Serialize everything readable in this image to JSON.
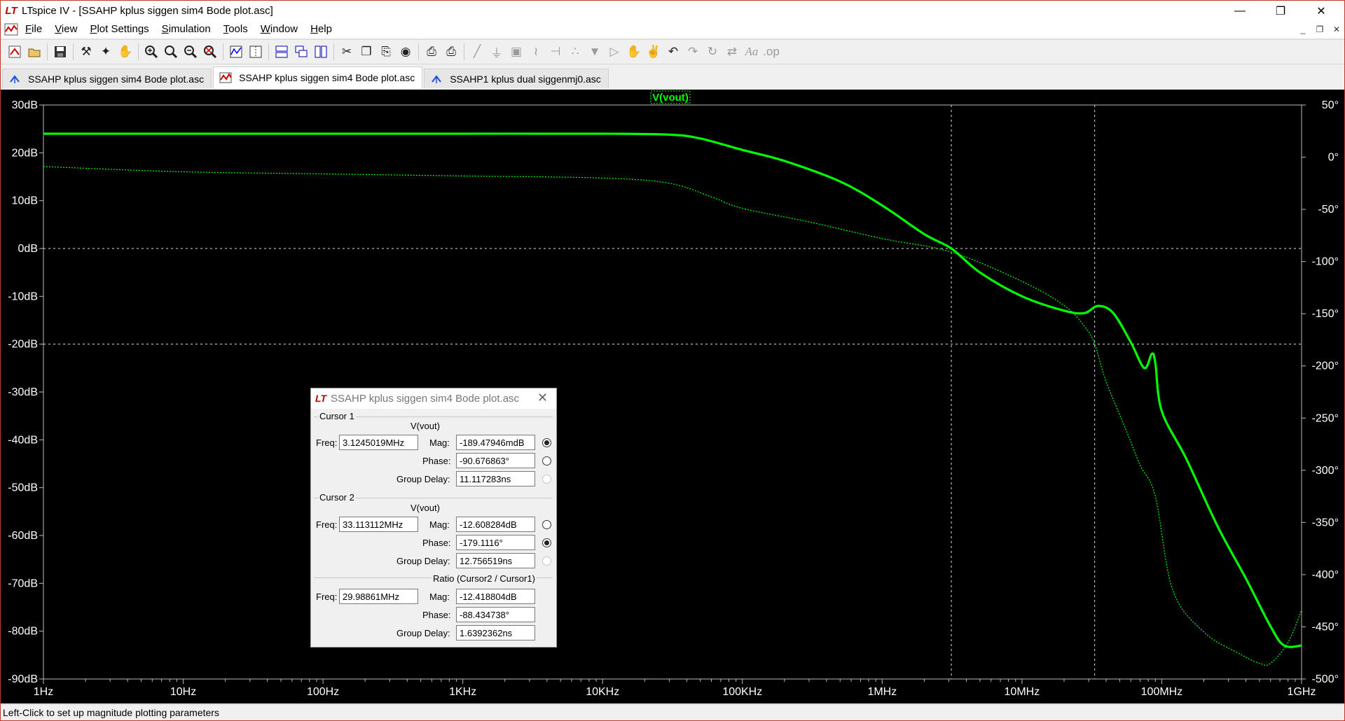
{
  "window": {
    "title": "LTspice IV - [SSAHP kplus siggen sim4 Bode plot.asc]",
    "controls": {
      "minimize": "—",
      "maximize": "❐",
      "close": "✕"
    }
  },
  "menu": {
    "items": [
      "File",
      "View",
      "Plot Settings",
      "Simulation",
      "Tools",
      "Window",
      "Help"
    ],
    "mdi_controls": [
      "_",
      "❐",
      "✕"
    ]
  },
  "toolbar": {
    "icons": [
      "new-schematic-icon",
      "open-icon",
      "save-icon",
      "control-panel-icon",
      "run-icon",
      "pan-hand-icon",
      "zoom-in-icon",
      "zoom-area-icon",
      "zoom-out-icon",
      "zoom-fit-icon",
      "autorange-icon",
      "annotate-icon",
      "tile-horizontal-icon",
      "cascade-icon",
      "tile-icon",
      "cut-icon",
      "copy-icon",
      "paste-icon",
      "find-icon",
      "print-preview-icon",
      "print-icon",
      "wire-icon",
      "ground-icon",
      "label-icon",
      "resistor-icon",
      "capacitor-icon",
      "inductor-icon",
      "diode-icon",
      "component-icon",
      "move-icon",
      "drag-icon",
      "undo-icon",
      "redo-icon",
      "rotate-icon",
      "mirror-icon",
      "text-icon",
      "spice-directive-icon"
    ]
  },
  "tabs": [
    {
      "label": "SSAHP kplus siggen sim4 Bode plot.asc",
      "icon": "schematic-icon",
      "active": false
    },
    {
      "label": "SSAHP kplus siggen sim4 Bode plot.asc",
      "icon": "waveform-icon",
      "active": true
    },
    {
      "label": "SSAHP1 kplus dual siggenmj0.asc",
      "icon": "schematic-icon",
      "active": false
    }
  ],
  "status": {
    "text": "Left-Click to set up magnitude plotting parameters"
  },
  "chart_data": {
    "type": "line",
    "title": "V(vout)",
    "x_scale": "log",
    "xlim": [
      1,
      1000000000
    ],
    "x_ticks": [
      "1Hz",
      "10Hz",
      "100Hz",
      "1KHz",
      "10KHz",
      "100KHz",
      "1MHz",
      "10MHz",
      "100MHz",
      "1GHz"
    ],
    "ylim": [
      -90,
      30
    ],
    "y_ticks": [
      "30dB",
      "20dB",
      "10dB",
      "0dB",
      "-10dB",
      "-20dB",
      "-30dB",
      "-40dB",
      "-50dB",
      "-60dB",
      "-70dB",
      "-80dB",
      "-90dB"
    ],
    "y2lim": [
      -500,
      50
    ],
    "y2_ticks": [
      "50°",
      "0°",
      "-50°",
      "-100°",
      "-150°",
      "-200°",
      "-250°",
      "-300°",
      "-350°",
      "-400°",
      "-450°",
      "-500°"
    ],
    "grid_y_dashed": [
      0,
      -20
    ],
    "cursors_x": [
      3124501.9,
      33113112
    ],
    "color": "#00ff00",
    "series": [
      {
        "name": "V(vout)",
        "style": "solid",
        "axis": "magnitude",
        "x": [
          1,
          10,
          100,
          1000,
          10000,
          30000,
          50000,
          100000,
          200000,
          500000,
          1000000,
          2000000,
          3124501.9,
          5000000,
          10000000,
          20000000,
          28000000,
          35000000,
          45000000,
          60000000,
          75000000,
          85000000,
          90000000,
          100000000,
          150000000,
          250000000,
          400000000,
          600000000,
          750000000,
          1000000000
        ],
        "y": [
          24,
          24,
          24,
          24,
          24,
          23.8,
          23,
          20.6,
          18.3,
          14,
          9,
          3,
          0,
          -5,
          -10,
          -13,
          -13.5,
          -12,
          -13.5,
          -19.6,
          -25,
          -22,
          -24,
          -34,
          -44,
          -58,
          -69,
          -79,
          -83,
          -83
        ]
      },
      {
        "name": "V(vout)",
        "style": "dashed",
        "axis": "phase",
        "x": [
          1,
          10,
          100,
          1000,
          10000,
          30000,
          60000,
          100000,
          300000,
          1000000,
          3124501.9,
          10000000,
          20000000,
          28000000,
          33113112,
          40000000,
          55000000,
          70000000,
          90000000,
          120000000,
          200000000,
          350000000,
          500000000,
          600000000,
          800000000,
          1000000000
        ],
        "y": [
          -9,
          -14,
          -16,
          -18,
          -20,
          -25,
          -38,
          -49,
          -62,
          -78,
          -91,
          -119,
          -142,
          -162,
          -179,
          -215,
          -260,
          -295,
          -325,
          -415,
          -455,
          -475,
          -485,
          -485,
          -465,
          -434
        ]
      }
    ]
  },
  "dialog": {
    "title": "SSAHP kplus siggen sim4 Bode plot.asc",
    "cursor1": {
      "label": "Cursor 1",
      "trace": "V(vout)",
      "freq_label": "Freq:",
      "freq": "3.1245019MHz",
      "mag_label": "Mag:",
      "mag": "-189.47946mdB",
      "phase_label": "Phase:",
      "phase": "-90.676863°",
      "gd_label": "Group Delay:",
      "gd": "11.117283ns"
    },
    "cursor2": {
      "label": "Cursor 2",
      "trace": "V(vout)",
      "freq_label": "Freq:",
      "freq": "33.113112MHz",
      "mag_label": "Mag:",
      "mag": "-12.608284dB",
      "phase_label": "Phase:",
      "phase": "-179.1116°",
      "gd_label": "Group Delay:",
      "gd": "12.756519ns"
    },
    "ratio": {
      "label": "Ratio (Cursor2 / Cursor1)",
      "freq_label": "Freq:",
      "freq": "29.98861MHz",
      "mag_label": "Mag:",
      "mag": "-12.418804dB",
      "phase_label": "Phase:",
      "phase": "-88.434738°",
      "gd_label": "Group Delay:",
      "gd": "1.6392362ns"
    }
  }
}
